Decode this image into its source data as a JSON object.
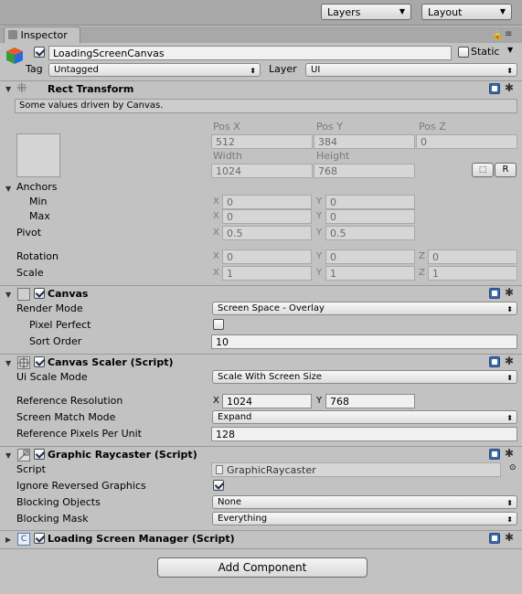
{
  "toolbar": {
    "layers": "Layers",
    "layout": "Layout"
  },
  "tab": {
    "label": "Inspector"
  },
  "object": {
    "name": "LoadingScreenCanvas",
    "static_label": "Static",
    "tag_label": "Tag",
    "tag_value": "Untagged",
    "layer_label": "Layer",
    "layer_value": "UI"
  },
  "rect": {
    "title": "Rect Transform",
    "note": "Some values driven by Canvas.",
    "pos_x_label": "Pos X",
    "pos_y_label": "Pos Y",
    "pos_z_label": "Pos Z",
    "pos_x": "512",
    "pos_y": "384",
    "pos_z": "0",
    "width_label": "Width",
    "height_label": "Height",
    "width": "1024",
    "height": "768",
    "r_btn": "R",
    "anchors": "Anchors",
    "min": "Min",
    "max": "Max",
    "pivot": "Pivot",
    "rotation": "Rotation",
    "scale": "Scale",
    "min_x": "0",
    "min_y": "0",
    "max_x": "0",
    "max_y": "0",
    "pivot_x": "0.5",
    "pivot_y": "0.5",
    "rot_x": "0",
    "rot_y": "0",
    "rot_z": "0",
    "scale_x": "1",
    "scale_y": "1",
    "scale_z": "1",
    "x": "X",
    "y": "Y",
    "z": "Z"
  },
  "canvas": {
    "title": "Canvas",
    "render_mode_label": "Render Mode",
    "render_mode": "Screen Space - Overlay",
    "pixel_perfect": "Pixel Perfect",
    "sort_order_label": "Sort Order",
    "sort_order": "10"
  },
  "scaler": {
    "title": "Canvas Scaler (Script)",
    "ui_scale_label": "Ui Scale Mode",
    "ui_scale": "Scale With Screen Size",
    "ref_res_label": "Reference Resolution",
    "ref_x": "1024",
    "ref_y": "768",
    "match_label": "Screen Match Mode",
    "match": "Expand",
    "ppu_label": "Reference Pixels Per Unit",
    "ppu": "128"
  },
  "raycaster": {
    "title": "Graphic Raycaster (Script)",
    "script_label": "Script",
    "script": "GraphicRaycaster",
    "ignore_label": "Ignore Reversed Graphics",
    "blocking_objects_label": "Blocking Objects",
    "blocking_objects": "None",
    "blocking_mask_label": "Blocking Mask",
    "blocking_mask": "Everything"
  },
  "manager": {
    "title": "Loading Screen Manager (Script)"
  },
  "add_component": "Add Component"
}
